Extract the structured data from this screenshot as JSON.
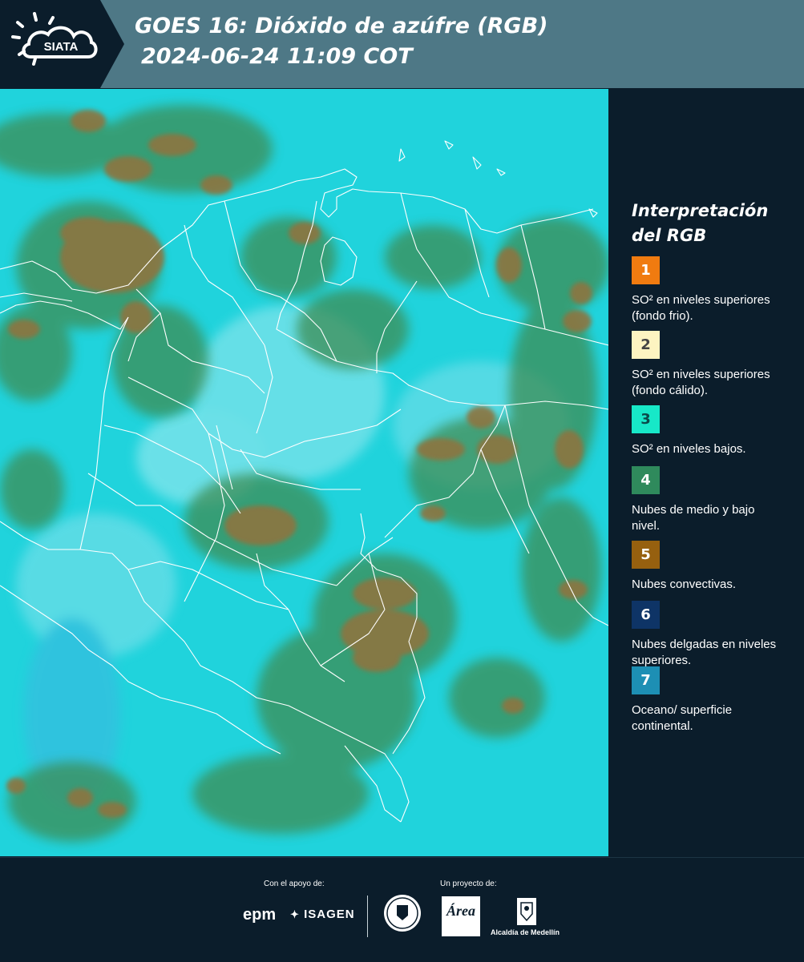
{
  "header": {
    "logo_text": "SIATA",
    "title_line1": "GOES 16: Dióxido de azúfre (RGB)",
    "title_line2": "2024-06-24 11:09 COT",
    "background": "#4e7886",
    "logo_background": "#0b1d2b"
  },
  "legend": {
    "title_line1": "Interpretación",
    "title_line2": "del RGB",
    "items": [
      {
        "number": "1",
        "color": "#f07b10",
        "text_color": "#ffffff",
        "label": "SO² en niveles superiores (fondo frio)."
      },
      {
        "number": "2",
        "color": "#fdf4c1",
        "text_color": "#444444",
        "label": "SO² en niveles superiores (fondo cálido)."
      },
      {
        "number": "3",
        "color": "#17e8c8",
        "text_color": "#0b4a4a",
        "label": "SO² en niveles bajos."
      },
      {
        "number": "4",
        "color": "#2f8a5c",
        "text_color": "#ffffff",
        "label": "Nubes de medio y bajo nivel."
      },
      {
        "number": "5",
        "color": "#96600f",
        "text_color": "#ffffff",
        "label": "Nubes convectivas."
      },
      {
        "number": "6",
        "color": "#0e3466",
        "text_color": "#ffffff",
        "label": "Nubes delgadas en niveles superiores."
      },
      {
        "number": "7",
        "color": "#1d8fb4",
        "text_color": "#ffffff",
        "label": "Oceano/ superficie continental."
      }
    ]
  },
  "map": {
    "background": "#1fd1da",
    "cloud_green": "#3e8e55",
    "cloud_brown": "#8d7440",
    "border_color": "#ffffff"
  },
  "footer": {
    "support_label": "Con el apoyo de:",
    "project_label": "Un proyecto de:",
    "sponsors": [
      "epm",
      "ISAGEN"
    ],
    "partners": [
      "Área Metropolitana Valle de Aburrá",
      "Alcaldía de Medellín"
    ],
    "alcaldia_text": "Alcaldía de Medellín",
    "area_text": "Área"
  }
}
